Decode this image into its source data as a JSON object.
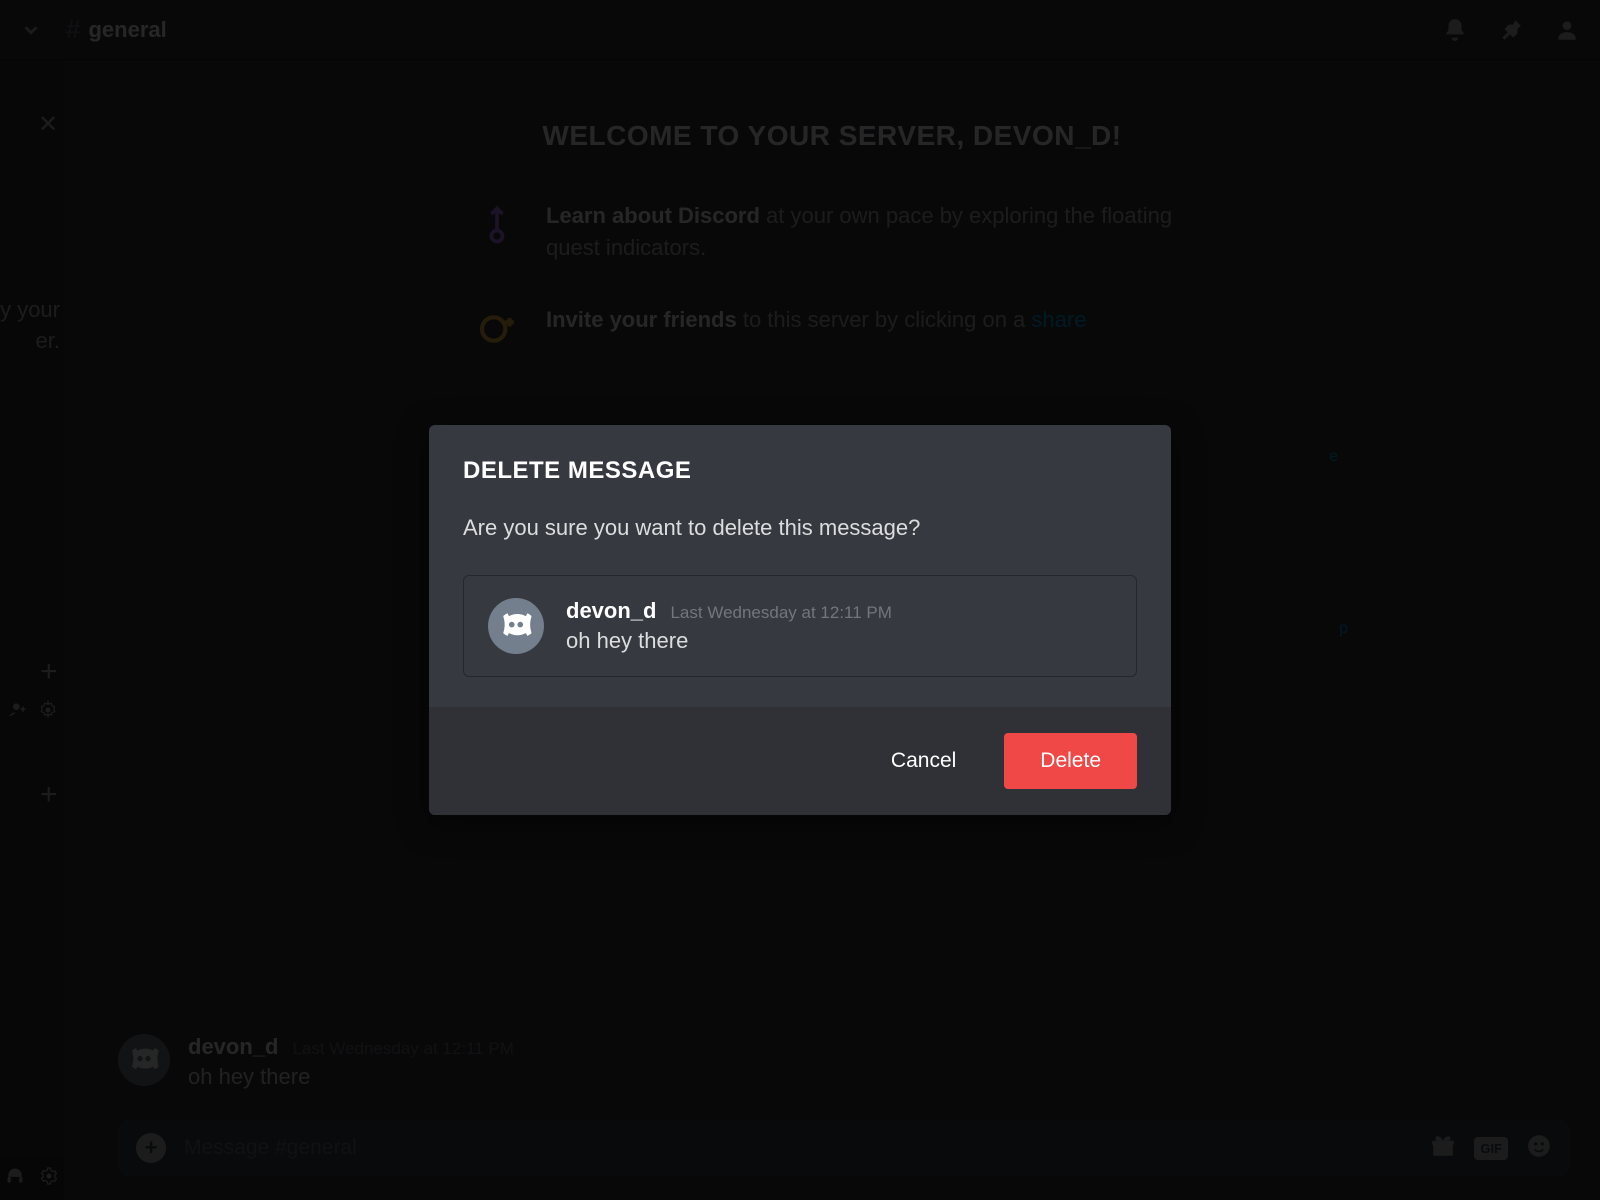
{
  "header": {
    "channel_name": "general"
  },
  "sidebar": {
    "setup_line1": "y your",
    "setup_line2": "er."
  },
  "welcome": {
    "title": "WELCOME TO YOUR SERVER, DEVON_D!",
    "item1_bold": "Learn about Discord",
    "item1_rest": " at your own pace by exploring the floating quest indicators.",
    "item2_bold": "Invite your friends",
    "item2_rest": " to this server by clicking on a ",
    "item2_link": "share",
    "item3_tail": "e",
    "item4_tail": "p"
  },
  "message_bg": {
    "author": "devon_d",
    "timestamp": "Last Wednesday at 12:11 PM",
    "content": "oh hey there"
  },
  "compose": {
    "placeholder": "Message #general",
    "gif_label": "GIF"
  },
  "modal": {
    "title": "DELETE MESSAGE",
    "question": "Are you sure you want to delete this message?",
    "preview": {
      "author": "devon_d",
      "timestamp": "Last Wednesday at 12:11 PM",
      "content": "oh hey there"
    },
    "cancel_label": "Cancel",
    "delete_label": "Delete"
  },
  "colors": {
    "danger": "#f04747",
    "link": "#00b0f4"
  }
}
